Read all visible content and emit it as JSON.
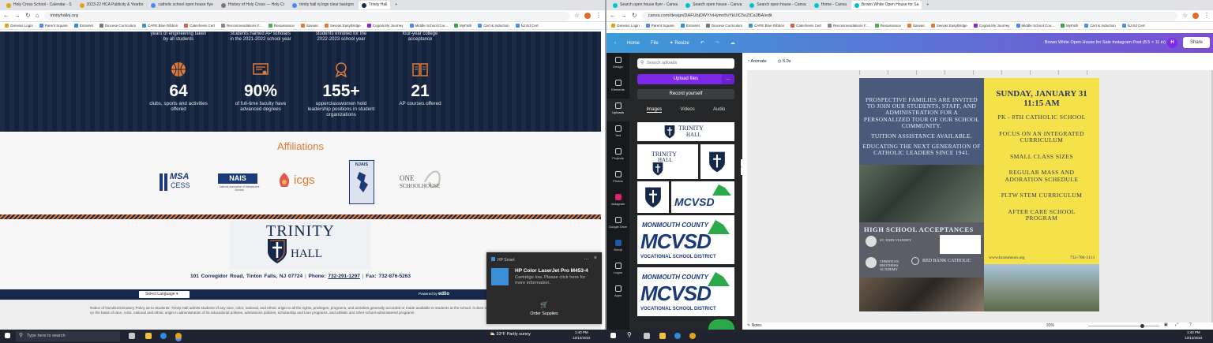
{
  "left_browser": {
    "tabs": [
      "Holy Cross School - Calendar - S",
      "2023-22 HCA Publicity & Yearbo",
      "catholic school open house flye",
      "History of Holy Cross — Holy Cr",
      "trinity hall nj logo clear backgro",
      "Trinity Hall"
    ],
    "url": "trinityhallnj.org",
    "bookmarks": [
      "Genesis Login",
      "Parent Square",
      "Entranet",
      "Diocese Curriculum",
      "CAPE Blue Ribbon",
      "Catechesis Cert",
      "Recommendations F...",
      "Renaissance",
      "Savvas",
      "Savvas EasyBridge",
      "Cognia My Journey",
      "Middle School Cou...",
      "MyPath",
      "Cert & Induction",
      "NJ Ed Cert"
    ]
  },
  "site": {
    "stats_top": [
      "years of engineering taken by all students",
      "students named AP scholars in the 2021-2022 school year",
      "students enrolled for the 2022-2023 school year",
      "four-year college acceptance"
    ],
    "stats": [
      {
        "num": "64",
        "label": "clubs, sports and activities offered"
      },
      {
        "num": "90%",
        "label": "of full-time faculty have advanced degrees"
      },
      {
        "num": "155+",
        "label": "upperclasswomen hold leadership positions in student organizations"
      },
      {
        "num": "21",
        "label": "AP courses offered"
      }
    ],
    "affiliations_title": "Affiliations",
    "logos": {
      "msa1": "MSA",
      "msa2": "CESS",
      "nais": "NAIS",
      "nais_sub": "National Association of Independent Schools",
      "icgs": "icgs",
      "njais": "NJAIS",
      "one": "ONE",
      "schoolhouse": "SCHOOLHOUSE"
    },
    "school_name_1": "TRINITY",
    "school_name_2": "HALL",
    "address": "101 Corregidor Road, Tinton Falls, NJ 07724",
    "phone_label": "Phone:",
    "phone": "732-291-1297",
    "fax": "Fax: 732-876-5263",
    "select_language": "Select Language",
    "powered_by": "Powered by",
    "edlio": "edlio",
    "notice": "Notice of Nondiscriminatory Policy as to Students: Trinity Hall admits students of any race, color, national, and ethnic origin to all the rights, privileges, programs, and activities generally accorded or made available to students at the school. It does not discriminate on the basis of race, color, national and ethnic origin in administration of its educational policies, admissions policies, scholarship and loan programs, and athletic and other school-administered programs."
  },
  "toast": {
    "app": "HP Smart",
    "title": "HP Color LaserJet Pro M453-4",
    "body": "Cartridge low. Please click here for more information.",
    "action": "Order Supplies"
  },
  "right_browser": {
    "tabs": [
      "Search open house flyer - Canva",
      "Search open house - Canva",
      "Search open house - Canva",
      "Home - Canva",
      "Brown White Open House for Sa"
    ],
    "url": "canva.com/design/DAFUbjDWY/vHymn5vYkUIC5oZlCa3BA/edit",
    "bookmarks": [
      "Genesis Login",
      "Parent Square",
      "Entranet",
      "Diocese Curriculum",
      "CAPE Blue Ribbon",
      "Catechesis Cert",
      "Recommendations F...",
      "Renaissance",
      "Savvas",
      "Savvas EasyBridge",
      "Cognia My Journey",
      "Middle School Cou...",
      "MyPath",
      "Cert & Induction",
      "NJ Ed Cert"
    ]
  },
  "canva": {
    "home": "Home",
    "file": "File",
    "resize": "Resize",
    "title": "Brown White Open House for Sale Instagram Post (8.5 × 11 in)",
    "avatar": "H",
    "share": "Share",
    "animate": "Animate",
    "duration": "5.0s",
    "rail": [
      "Design",
      "Elements",
      "Uploads",
      "Text",
      "Projects",
      "Photos",
      "Instagram",
      "Google Drive",
      "Emoji",
      "Logos",
      "Apps"
    ],
    "search_placeholder": "Search uploads",
    "upload_files": "Upload files",
    "record": "Record yourself",
    "panel_tabs": [
      "Images",
      "Videos",
      "Audio"
    ],
    "thumb_text": {
      "trinity": "TRINITY",
      "hall": "HALL",
      "monmouth": "MONMOUTH COUNTY",
      "mcvsd": "MCVSD",
      "vocational": "VOCATIONAL SCHOOL DISTRICT"
    },
    "poster_left": "PROSPECTIVE FAMILIES ARE INVITED TO JOIN OUR STUDENTS, STAFF, AND ADMINISTRATION FOR A PERSONALIZED TOUR OF OUR SCHOOL COMMUNITY.",
    "poster_left2": "TUITION ASSISTANCE AVAILABLE.",
    "poster_left3": "EDUCATING THE NEXT GENERATION OF CATHOLIC LEADERS SINCE 1941.",
    "hs_accept": "HIGH SCHOOL ACCEPTANCES",
    "acc": [
      "ST. JOHN VIANNEY",
      "CHRISTIAN BROTHERS ACADEMY",
      "RED BANK CATHOLIC"
    ],
    "poster_right": [
      "SUNDAY, JANUARY 31",
      "11:15 AM",
      "PK - 8TH CATHOLIC SCHOOL",
      "FOCUS ON AN INTEGRATED CURRICULUM",
      "SMALL CLASS SIZES",
      "REGULAR MASS AND ADORATION SCHEDULE",
      "PLTW STEM CURRICULUM",
      "AFTER CARE SCHOOL PROGRAM"
    ],
    "poster_url": "www.hcarumson.org",
    "poster_phone": "732-706-3113",
    "notes": "Notes",
    "zoom": "93%"
  },
  "taskbar": {
    "search": "Type here to search",
    "weather": "33°F  Partly sunny",
    "time_left": "1:40 PM",
    "date_left": "12/12/2022",
    "time_right": "1:40 PM",
    "date_right": "12/12/2022"
  },
  "colors": {
    "navy": "#16284a",
    "orange": "#e07a35",
    "canva_purple": "#7d2ae8",
    "poster_yellow": "#f5e14a"
  }
}
